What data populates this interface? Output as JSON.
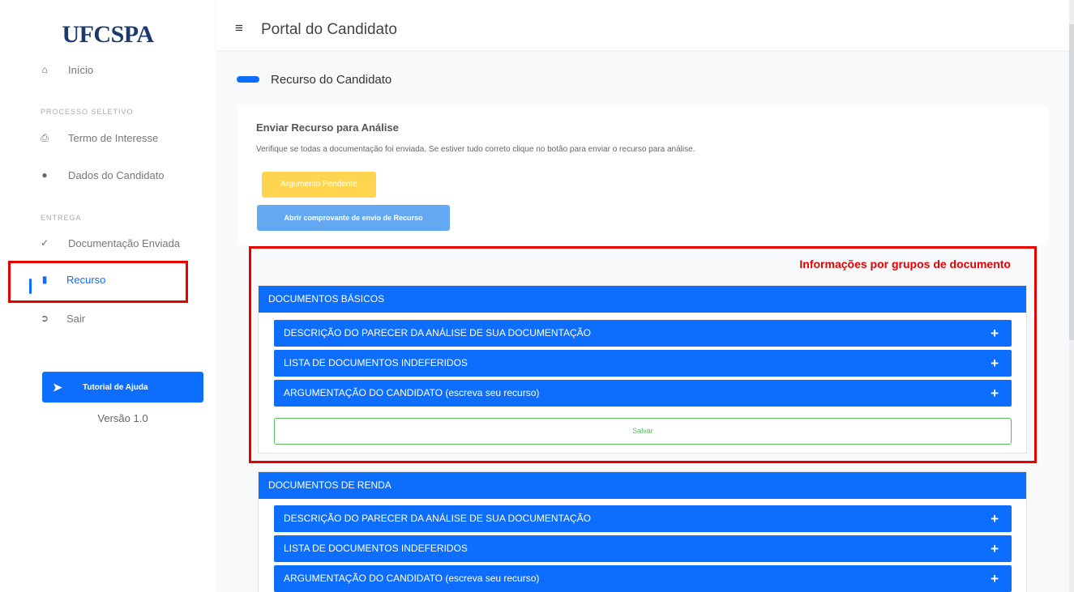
{
  "sidebar": {
    "logo": "UFCSPA",
    "home": {
      "label": "Início",
      "icon": "home-icon"
    },
    "section_processo": "PROCESSO SELETIVO",
    "termo": {
      "label": "Termo de Interesse",
      "icon": "print-icon"
    },
    "dados": {
      "label": "Dados do Candidato",
      "icon": "user-icon"
    },
    "section_entrega": "ENTREGA",
    "documentacao": {
      "label": "Documentação Enviada",
      "icon": "check-icon"
    },
    "recurso": {
      "label": "Recurso",
      "icon": "clipboard-icon"
    },
    "sair": {
      "label": "Sair",
      "icon": "sign-out-icon"
    },
    "help_button": "Tutorial de Ajuda",
    "version": "Versão 1.0"
  },
  "header": {
    "title": "Portal do Candidato",
    "menu_icon": "hamburger-icon"
  },
  "section": {
    "title": "Recurso do Candidato"
  },
  "card": {
    "title": "Enviar Recurso para Análise",
    "description": "Verifique se todas a documentação foi enviada. Se estiver tudo correto clique no botão para enviar o recurso para análise.",
    "status_button": "Argumento Pendente",
    "receipt_button": "Abrir comprovante de envio de Recurso"
  },
  "annotation": "Informações por grupos de documento",
  "groups": [
    {
      "title": "DOCUMENTOS BÁSICOS",
      "rows": [
        "DESCRIÇÃO DO PARECER DA ANÁLISE DE SUA DOCUMENTAÇÃO",
        "LISTA DE DOCUMENTOS INDEFERIDOS",
        "ARGUMENTAÇÃO DO CANDIDATO (escreva seu recurso)"
      ],
      "save": "Salvar"
    },
    {
      "title": "DOCUMENTOS DE RENDA",
      "rows": [
        "DESCRIÇÃO DO PARECER DA ANÁLISE DE SUA DOCUMENTAÇÃO",
        "LISTA DE DOCUMENTOS INDEFERIDOS",
        "ARGUMENTAÇÃO DO CANDIDATO (escreva seu recurso)"
      ]
    }
  ],
  "colors": {
    "primary": "#0d6efd",
    "warning": "#ffd54f",
    "success": "#5cb85c",
    "highlight": "#e60000"
  }
}
